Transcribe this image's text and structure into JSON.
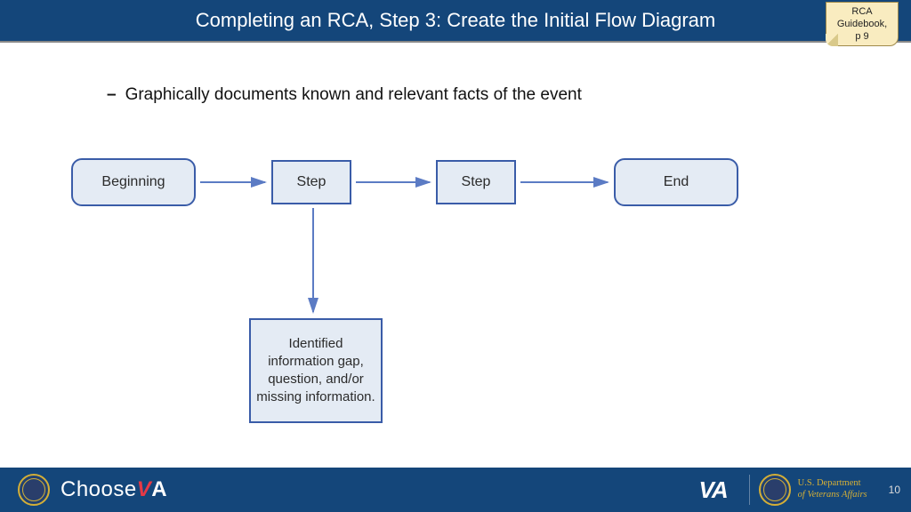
{
  "header": {
    "title": "Completing an RCA, Step 3: Create the Initial Flow Diagram"
  },
  "note": {
    "line1": "RCA",
    "line2": "Guidebook,",
    "line3": "p 9"
  },
  "bullet": {
    "text": "Graphically documents known and relevant facts of the event"
  },
  "flow": {
    "beginning": "Beginning",
    "step1": "Step",
    "step2": "Step",
    "end": "End",
    "gap": "Identified information gap, question, and/or missing information."
  },
  "footer": {
    "choose_pre": "Choose",
    "choose_v": "V",
    "choose_a": "A",
    "va": "VA",
    "dept_l1": "U.S. Department",
    "dept_l2": "of Veterans Affairs",
    "page": "10"
  }
}
